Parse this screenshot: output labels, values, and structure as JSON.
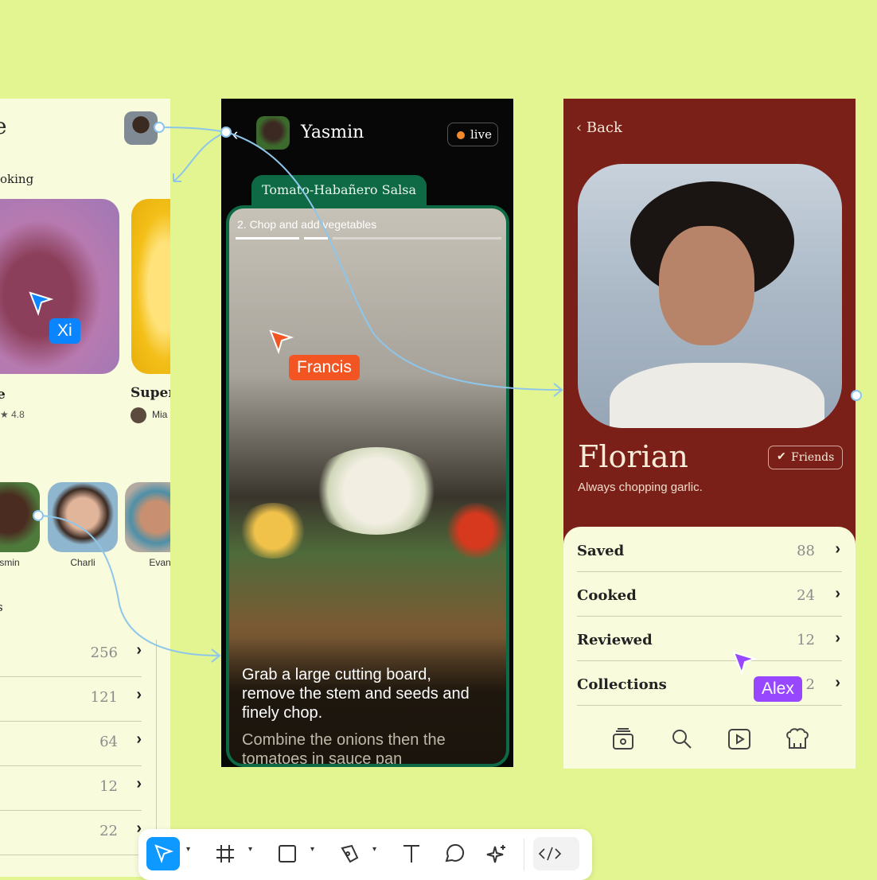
{
  "left_frame": {
    "heading_fragment": "e",
    "section_label": "oking",
    "card1_title": "e",
    "card1_rating": "★ 4.8",
    "card2_title": "Super",
    "card2_author": "Mia",
    "friends_label": "s",
    "friends": [
      {
        "name": "smin"
      },
      {
        "name": "Charli"
      },
      {
        "name": "Evan"
      }
    ],
    "list_values": [
      "256",
      "121",
      "64",
      "12",
      "22"
    ],
    "chevron": "›"
  },
  "middle_phone": {
    "user_name": "Yasmin",
    "live_label": "live",
    "recipe_tab": "Tomato-Habañero Salsa",
    "step_label": "2.  Chop and add vegetables",
    "instruction_main": "Grab a large cutting board, remove the stem and seeds and finely chop.",
    "instruction_next": "Combine the onions then the tomatoes in sauce pan"
  },
  "profile": {
    "back_label": "Back",
    "name": "Florian",
    "bio": "Always chopping garlic.",
    "friends_button": "Friends",
    "stats": [
      {
        "label": "Saved",
        "value": "88"
      },
      {
        "label": "Cooked",
        "value": "24"
      },
      {
        "label": "Reviewed",
        "value": "12"
      },
      {
        "label": "Collections",
        "value": "2"
      }
    ],
    "nav_icons": [
      "home-icon",
      "search-icon",
      "play-icon",
      "chef-hat-icon"
    ]
  },
  "cursors": [
    {
      "name": "Xi",
      "color": "#0a84ff"
    },
    {
      "name": "Francis",
      "color": "#f25522"
    },
    {
      "name": "Alex",
      "color": "#9747ff"
    }
  ],
  "toolbar": {
    "tools": [
      "move-tool",
      "frame-tool",
      "rectangle-tool",
      "pen-tool",
      "text-tool",
      "comment-tool",
      "actions-tool",
      "dev-mode-toggle"
    ],
    "active_tool": "move-tool"
  },
  "colors": {
    "canvas": "#e2f590",
    "profile_bg": "#7a2018",
    "recipe_green": "#0d6a45",
    "connector": "#8ec6ea",
    "active_tool": "#0d99ff"
  }
}
